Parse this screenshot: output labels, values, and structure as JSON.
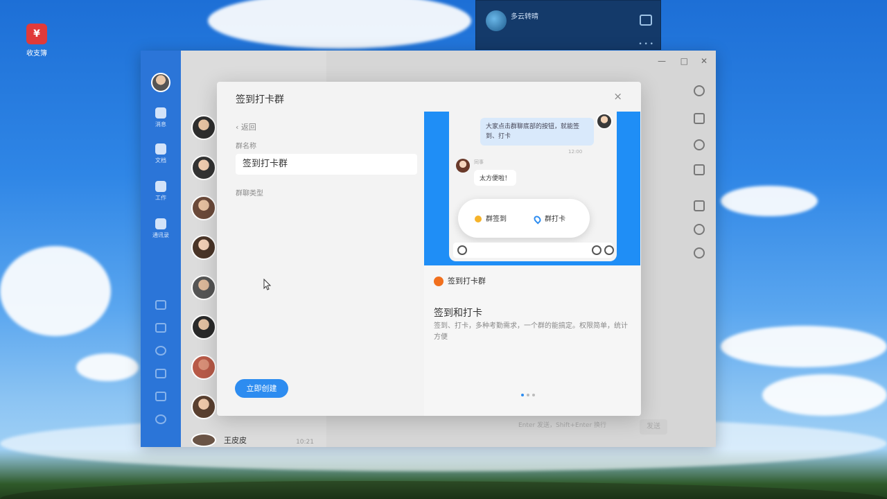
{
  "desktop": {
    "icon_label": "收支簿"
  },
  "top_widget": {
    "line1": "多云转晴"
  },
  "app": {
    "nav_items": [
      "消息",
      "文档",
      "工作",
      "通讯录"
    ],
    "contacts": [
      {
        "name": "",
        "time": ""
      },
      {
        "name": "",
        "time": ""
      },
      {
        "name": "",
        "time": ""
      },
      {
        "name": "",
        "time": ""
      },
      {
        "name": "",
        "time": ""
      },
      {
        "name": "",
        "time": ""
      },
      {
        "name": "",
        "time": ""
      },
      {
        "name": "",
        "time": ""
      },
      {
        "name": "王皮皮",
        "time": "10:21"
      }
    ],
    "send_label": "发送",
    "input_hint": "Enter 发送，Shift+Enter 换行"
  },
  "dialog": {
    "title": "签到打卡群",
    "back_label": "返回",
    "group_name_label": "群名称",
    "group_name_value": "签到打卡群",
    "group_intro_label": "群聊类型",
    "create_button": "立即创建",
    "close": "×"
  },
  "preview": {
    "bubble_right": "大家点击群聊底部的按钮，就能签到、打卡",
    "timestamp": "12:00",
    "sender": "同事",
    "bubble_left": "太方便啦！",
    "popup_item1": "群签到",
    "popup_item2": "群打卡",
    "app_name": "签到打卡群",
    "feature_title": "签到和打卡",
    "feature_desc": "签到、打卡，多种考勤需求，一个群的能搞定。权限简单，统计方便"
  },
  "colors": {
    "nav_blue": "#2b75d8",
    "accent_blue": "#2d8cf0",
    "app_orange": "#f1701e"
  }
}
